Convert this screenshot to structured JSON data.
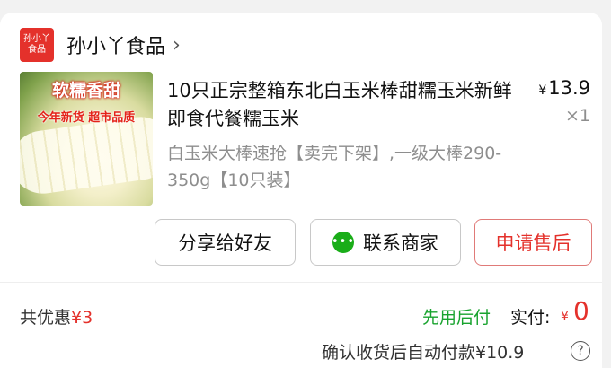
{
  "shop": {
    "logo_line1": "孙小丫",
    "logo_line2": "食品",
    "name": "孙小丫食品",
    "chevron": "›"
  },
  "product": {
    "image_text1": "软糯香甜",
    "image_text2": "今年新货 超市品质",
    "title": "10只正宗整箱东北白玉米棒甜糯玉米新鲜即食代餐糯玉米",
    "spec": "白玉米大棒速抢【卖完下架】,一级大棒290-350g【10只装】",
    "price_symbol": "¥",
    "price": "13.9",
    "quantity": "×1"
  },
  "actions": {
    "share": "分享给好友",
    "contact": "联系商家",
    "after_sale": "申请售后"
  },
  "summary": {
    "discount_label": "共优惠",
    "discount_amount": "¥3",
    "pay_later": "先用后付",
    "paid_label": "实付:",
    "paid_symbol": "¥",
    "paid_value": "0",
    "auto_pay": "确认收货后自动付款¥10.9",
    "help": "?"
  },
  "colors": {
    "accent_red": "#e4312b",
    "green": "#19a32f",
    "wechat_green": "#1aad19"
  },
  "icons": [
    "shop-logo",
    "chevron-right-icon",
    "chat-bubble-icon",
    "help-icon"
  ]
}
